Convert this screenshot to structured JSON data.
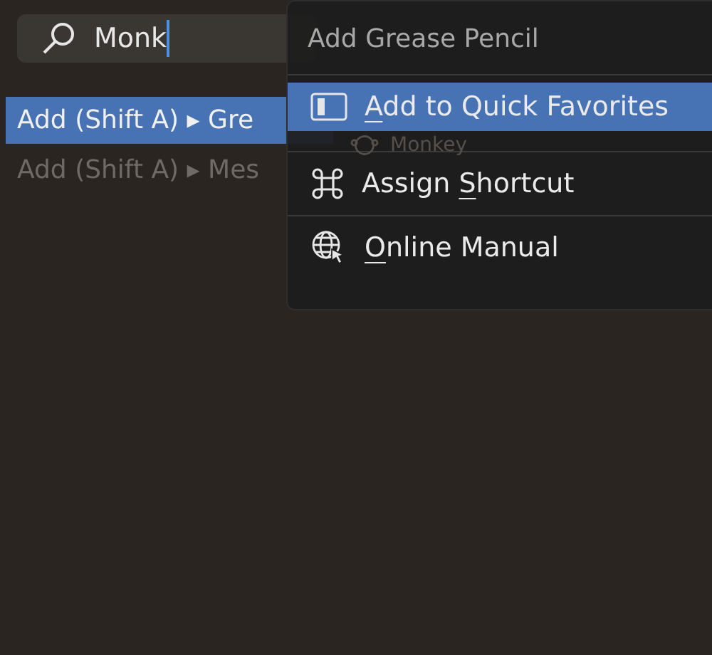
{
  "search": {
    "value": "Monk"
  },
  "results": [
    {
      "label": "Add (Shift A) ▸ Gre",
      "selected": true
    },
    {
      "label": "Add (Shift A) ▸ Mes",
      "selected": false
    }
  ],
  "covered_result": {
    "label": "Monkey"
  },
  "context_menu": {
    "title": "Add Grease Pencil",
    "items": [
      {
        "kind": "favorites",
        "mnemonic": "A",
        "rest": "dd to Quick Favorites",
        "selected": true
      },
      {
        "kind": "shortcut",
        "prefix": "Assign ",
        "mnemonic": "S",
        "rest": "hortcut",
        "selected": false
      },
      {
        "kind": "manual",
        "mnemonic": "O",
        "rest": "nline Manual",
        "selected": false
      }
    ]
  }
}
